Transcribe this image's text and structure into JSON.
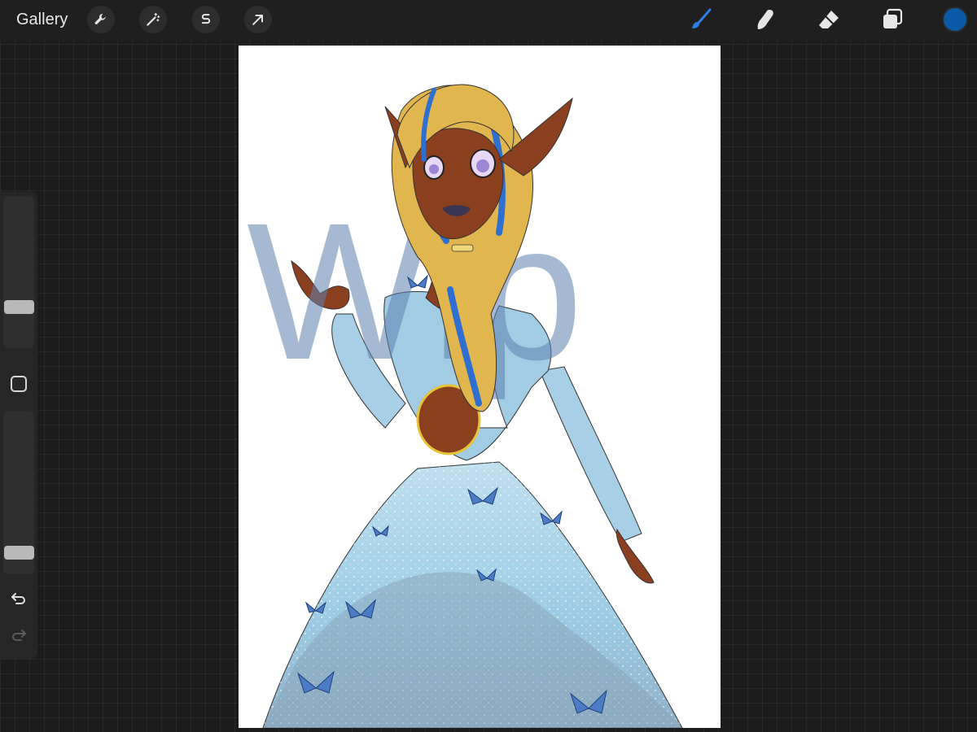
{
  "app": {
    "gallery_label": "Gallery"
  },
  "toolbar": {
    "left_tools": [
      {
        "name": "actions",
        "icon": "wrench-icon"
      },
      {
        "name": "adjustments",
        "icon": "magic-wand-icon"
      },
      {
        "name": "selection",
        "icon": "selection-s-icon"
      },
      {
        "name": "transform",
        "icon": "arrow-cursor-icon"
      }
    ],
    "right_tools": [
      {
        "name": "brush",
        "icon": "brush-icon",
        "active": true
      },
      {
        "name": "smudge",
        "icon": "smudge-finger-icon",
        "active": false
      },
      {
        "name": "eraser",
        "icon": "eraser-icon",
        "active": false
      },
      {
        "name": "layers",
        "icon": "layers-icon",
        "active": false
      }
    ],
    "current_color": "#0a5aa8"
  },
  "colors": {
    "accent_active": "#2f7ee6",
    "icon": "#e6e6e6"
  },
  "sidebar": {
    "brush_size_level": 0.25,
    "opacity_level": 0.1,
    "undo_icon": "undo-arrow-icon",
    "redo_icon": "redo-arrow-icon",
    "modifier_icon": "square-modifier-icon"
  },
  "canvas": {
    "watermark_text": "Wip",
    "artwork_description_icon": "artwork-illustration"
  }
}
